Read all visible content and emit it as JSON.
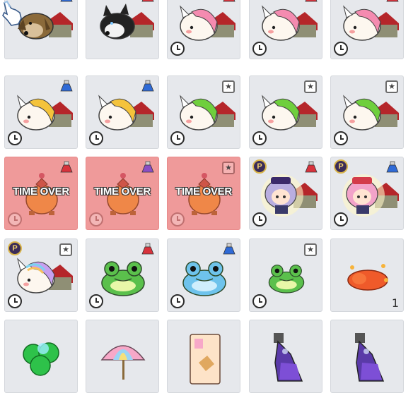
{
  "inventory": {
    "expired_label": "TIME OVER",
    "premium_label": "P",
    "star_glyph": "★",
    "colors": {
      "slot": "#e6e8ec",
      "expired": "#ef9a9a"
    },
    "rows": [
      [
        {
          "icon": "beagle-dog-pet-icon",
          "badge": "blue-potion",
          "clock": false
        },
        {
          "icon": "husky-dog-pet-icon",
          "badge": "red-potion",
          "clock": false
        },
        {
          "icon": "pink-unicorn-pet-icon",
          "badge": "red-potion",
          "clock": true
        },
        {
          "icon": "pink-unicorn-pet-icon",
          "badge": "red-potion",
          "clock": true
        },
        {
          "icon": "pink-unicorn-pet-icon",
          "badge": "red-potion",
          "clock": true
        }
      ],
      [
        {
          "icon": "yellow-unicorn-pet-icon",
          "badge": "blue-potion",
          "clock": true
        },
        {
          "icon": "yellow-unicorn-pet-icon",
          "badge": "blue-potion",
          "clock": true
        },
        {
          "icon": "green-unicorn-pet-icon",
          "badge": "star",
          "clock": true
        },
        {
          "icon": "green-unicorn-pet-icon",
          "badge": "star",
          "clock": true
        },
        {
          "icon": "green-unicorn-pet-icon",
          "badge": "star",
          "clock": true
        }
      ],
      [
        {
          "icon": "orange-bag-pet-icon",
          "badge": "red-potion",
          "clock": true,
          "expired": true
        },
        {
          "icon": "orange-bag-pet-icon",
          "badge": "purple-potion",
          "clock": true,
          "expired": true
        },
        {
          "icon": "orange-bag-pet-icon",
          "badge": "star",
          "clock": true,
          "expired": true
        },
        {
          "icon": "silver-hair-girl-pet-icon",
          "badge": "red-potion",
          "clock": true,
          "premium": true
        },
        {
          "icon": "pink-hair-girl-pet-icon",
          "badge": "blue-potion",
          "clock": true,
          "premium": true
        }
      ],
      [
        {
          "icon": "rainbow-unicorn-pet-icon",
          "badge": "star",
          "clock": true,
          "premium": true
        },
        {
          "icon": "green-frog-pet-icon",
          "badge": "red-potion",
          "clock": true
        },
        {
          "icon": "blue-frog-pet-icon",
          "badge": "blue-potion",
          "clock": true
        },
        {
          "icon": "small-green-frog-pet-icon",
          "badge": "star",
          "clock": true
        },
        {
          "icon": "red-ribbon-item-icon",
          "badge": "none",
          "clock": false,
          "quantity": "1"
        }
      ],
      [
        {
          "icon": "green-clover-item-icon",
          "badge": "none",
          "clock": false
        },
        {
          "icon": "rainbow-umbrella-item-icon",
          "badge": "none",
          "clock": false
        },
        {
          "icon": "scroll-card-item-icon",
          "badge": "none",
          "clock": false
        },
        {
          "icon": "purple-potion-bottle-item-icon",
          "badge": "none",
          "clock": false
        },
        {
          "icon": "purple-potion-bottle-item-icon",
          "badge": "none",
          "clock": false
        }
      ]
    ]
  }
}
